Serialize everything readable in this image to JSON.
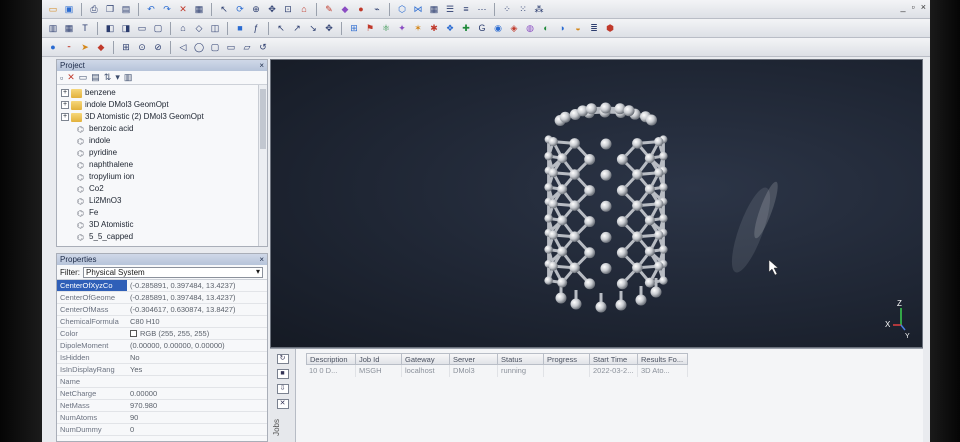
{
  "toolbar": {
    "row1_icons": [
      "folder-icon",
      "save-icon",
      "print-icon",
      "copy-icon",
      "paste-icon",
      "undo-icon",
      "redo-icon",
      "cut-icon",
      "select-icon",
      "rotate-icon",
      "zoom-icon",
      "translate-icon",
      "fit-icon",
      "sketch-icon",
      "measure-icon",
      "atom-icon",
      "bond-icon",
      "ring-icon",
      "grid-icon",
      "options-icon"
    ],
    "row2_icons": [
      "chart-icon",
      "table-icon",
      "text-icon",
      "align-icon",
      "layout-icon",
      "color-icon",
      "display-icon",
      "lattice-icon",
      "symmetry-icon",
      "build-icon",
      "crystal-icon",
      "modules-icon"
    ],
    "row3_icons": [
      "atom-color-icon",
      "label-icon",
      "arrow-icon",
      "polyhedra-icon",
      "surface-icon",
      "field-icon",
      "ball-icon",
      "stick-icon",
      "line-icon",
      "cpk-icon"
    ],
    "window_controls": [
      "_",
      "▫",
      "×"
    ]
  },
  "project": {
    "title": "Project",
    "close": "×",
    "items": [
      {
        "label": "benzene",
        "type": "folder",
        "expandable": true
      },
      {
        "label": "indole DMol3 GeomOpt",
        "type": "folder",
        "expandable": true
      },
      {
        "label": "3D Atomistic (2) DMol3 GeomOpt",
        "type": "folder",
        "expandable": true
      },
      {
        "label": "benzoic acid",
        "type": "mol"
      },
      {
        "label": "indole",
        "type": "mol"
      },
      {
        "label": "pyridine",
        "type": "mol"
      },
      {
        "label": "naphthalene",
        "type": "mol"
      },
      {
        "label": "tropylium ion",
        "type": "mol"
      },
      {
        "label": "Co2",
        "type": "mol"
      },
      {
        "label": "Li2MnO3",
        "type": "mol"
      },
      {
        "label": "Fe",
        "type": "mol"
      },
      {
        "label": "3D Atomistic",
        "type": "mol"
      },
      {
        "label": "5_5_capped",
        "type": "mol"
      }
    ]
  },
  "properties": {
    "title": "Properties",
    "close": "×",
    "filter_label": "Filter:",
    "filter_value": "Physical System",
    "rows": [
      {
        "key": "CenterOfXyzCo",
        "value": "(-0.285891, 0.397484, 13.4237)"
      },
      {
        "key": "CenterOfGeome",
        "value": "(-0.285891, 0.397484, 13.4237)"
      },
      {
        "key": "CenterOfMass",
        "value": "(-0.304617, 0.630874, 13.8427)"
      },
      {
        "key": "ChemicalFormula",
        "value": "C80 H10"
      },
      {
        "key": "Color",
        "value": "RGB (255, 255, 255)",
        "swatch": "#ffffff"
      },
      {
        "key": "DipoleMoment",
        "value": "(0.00000, 0.00000, 0.00000)"
      },
      {
        "key": "IsHidden",
        "value": "No"
      },
      {
        "key": "IsInDisplayRang",
        "value": "Yes"
      },
      {
        "key": "Name",
        "value": ""
      },
      {
        "key": "NetCharge",
        "value": "0.00000"
      },
      {
        "key": "NetMass",
        "value": "970.980"
      },
      {
        "key": "NumAtoms",
        "value": "90"
      },
      {
        "key": "NumDummy",
        "value": "0"
      }
    ]
  },
  "viewport": {
    "axis_z": "Z",
    "axis_x": "X",
    "axis_y": "Y",
    "background": "#1f2634",
    "atom_color": "#c9ccd1"
  },
  "jobs": {
    "label": "Jobs",
    "columns": [
      "Description",
      "Job Id",
      "Gateway",
      "Server",
      "Status",
      "Progress",
      "Start Time",
      "Results Fo..."
    ],
    "rows": [
      {
        "description": "10 0 D...",
        "job_id": "MSGH",
        "gateway": "localhost",
        "server": "DMol3",
        "status": "running",
        "progress": "",
        "start_time": "2022-03-2...",
        "results": "3D Ato..."
      }
    ]
  }
}
